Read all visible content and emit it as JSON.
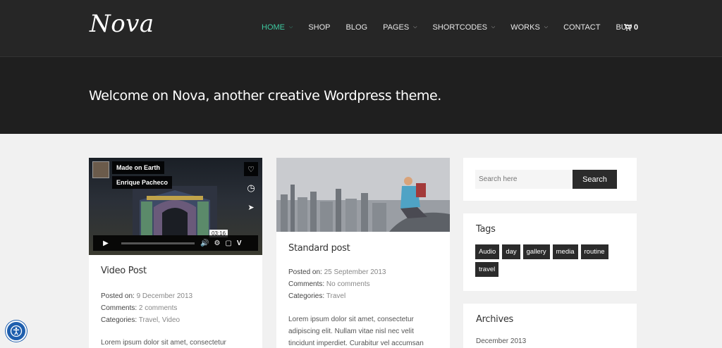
{
  "header": {
    "logo": "Nova",
    "nav": [
      {
        "label": "HOME",
        "dropdown": true,
        "active": true
      },
      {
        "label": "SHOP",
        "dropdown": false
      },
      {
        "label": "BLOG",
        "dropdown": false
      },
      {
        "label": "PAGES",
        "dropdown": true
      },
      {
        "label": "SHORTCODES",
        "dropdown": true
      },
      {
        "label": "WORKS",
        "dropdown": true
      },
      {
        "label": "CONTACT",
        "dropdown": false
      },
      {
        "label": "BUY",
        "dropdown": false
      }
    ],
    "cart_count": "0",
    "accent": "#3ec9a0"
  },
  "hero": {
    "title": "Welcome on Nova, another creative Wordpress theme."
  },
  "posts": [
    {
      "video": {
        "channel": "Made on Earth",
        "author": "Enrique Pacheco",
        "time": "03:16"
      },
      "title": "Video Post",
      "posted_label": "Posted on:",
      "posted_value": "9 December 2013",
      "comments_label": "Comments:",
      "comments_value": "2 comments",
      "categories_label": "Categories:",
      "categories_value": "Travel, Video",
      "excerpt": "Lorem ipsum dolor sit amet, consectetur"
    },
    {
      "title": "Standard post",
      "posted_label": "Posted on:",
      "posted_value": "25 September 2013",
      "comments_label": "Comments:",
      "comments_value": "No comments",
      "categories_label": "Categories:",
      "categories_value": "Travel",
      "excerpt": "Lorem ipsum dolor sit amet, consectetur adipiscing elit. Nullam vitae nisl nec velit tincidunt imperdiet. Curabitur vel accumsan est."
    }
  ],
  "sidebar": {
    "search": {
      "placeholder": "Search here",
      "button": "Search"
    },
    "tags": {
      "title": "Tags",
      "items": [
        "Audio",
        "day",
        "gallery",
        "media",
        "routine",
        "travel"
      ]
    },
    "archives": {
      "title": "Archives",
      "items": [
        "December 2013"
      ]
    }
  }
}
